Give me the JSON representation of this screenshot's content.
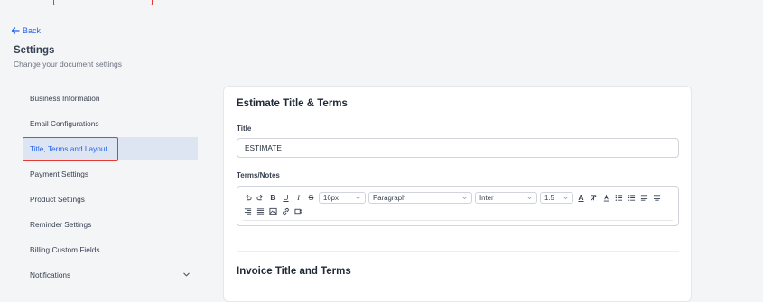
{
  "nav": {
    "back_label": "Back"
  },
  "header": {
    "title": "Settings",
    "subtitle": "Change your document settings"
  },
  "sidebar": {
    "items": [
      {
        "label": "Business Information",
        "active": false
      },
      {
        "label": "Email Configurations",
        "active": false
      },
      {
        "label": "Title, Terms and Layout",
        "active": true
      },
      {
        "label": "Payment Settings",
        "active": false
      },
      {
        "label": "Product Settings",
        "active": false
      },
      {
        "label": "Reminder Settings",
        "active": false
      },
      {
        "label": "Billing Custom Fields",
        "active": false
      },
      {
        "label": "Notifications",
        "active": false,
        "icon": "chevron-down-icon"
      }
    ]
  },
  "estimate": {
    "section_title": "Estimate Title & Terms",
    "title_label": "Title",
    "title_value": "ESTIMATE",
    "terms_label": "Terms/Notes",
    "toolbar": {
      "font_size": "16px",
      "block_format": "Paragraph",
      "font_family": "Inter",
      "line_height": "1.5",
      "icons_row1": [
        "undo-icon",
        "redo-icon",
        "bold-icon",
        "underline-icon",
        "italic-icon",
        "strikethrough-icon"
      ],
      "icons_row1_after": [
        "text-color-icon",
        "clear-format-icon",
        "highlight-icon",
        "bullet-list-icon",
        "numbered-list-icon",
        "align-left-icon",
        "align-center-icon"
      ],
      "icons_row2": [
        "align-right-icon",
        "align-justify-icon",
        "image-icon",
        "link-icon",
        "embed-icon"
      ]
    }
  },
  "invoice": {
    "section_title": "Invoice Title and Terms"
  },
  "colors": {
    "accent": "#2563eb",
    "highlight_border": "#e53935",
    "active_bg": "#dde5f3"
  }
}
